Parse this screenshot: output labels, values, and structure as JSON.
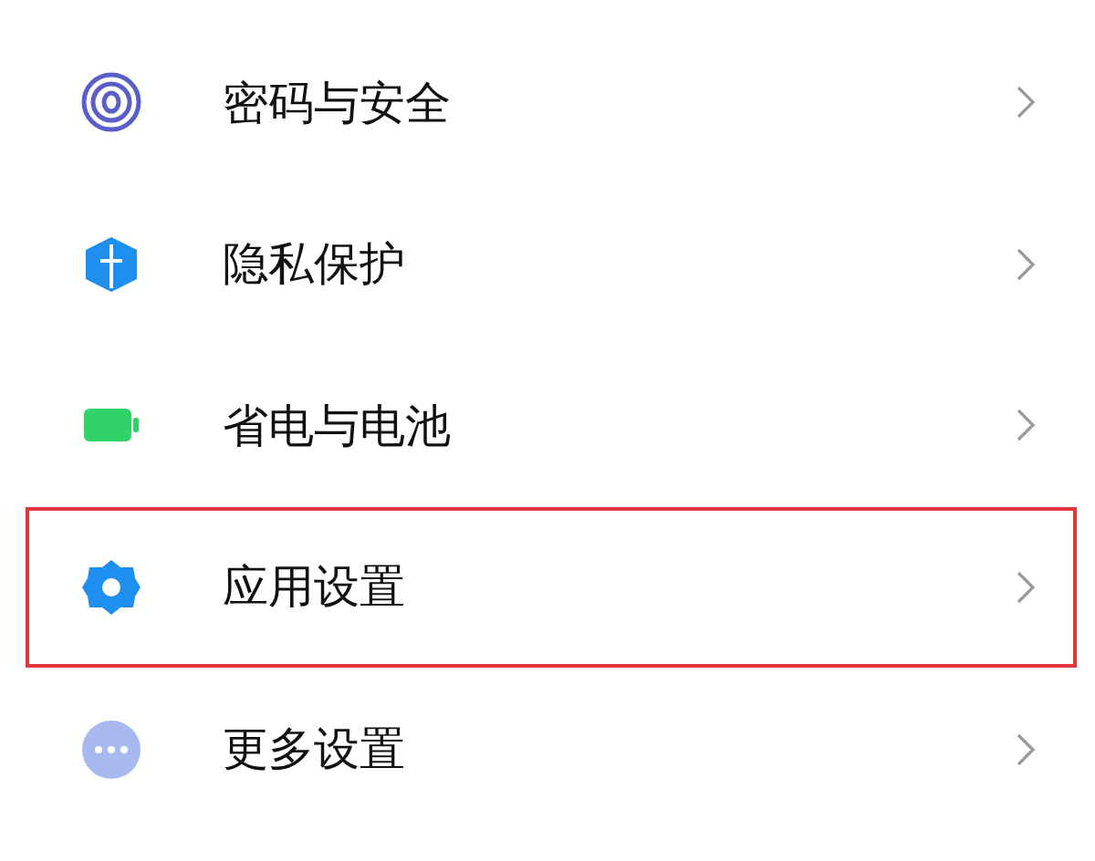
{
  "items": [
    {
      "label": "密码与安全",
      "highlighted": false
    },
    {
      "label": "隐私保护",
      "highlighted": false
    },
    {
      "label": "省电与电池",
      "highlighted": false
    },
    {
      "label": "应用设置",
      "highlighted": true
    },
    {
      "label": "更多设置",
      "highlighted": false
    }
  ]
}
